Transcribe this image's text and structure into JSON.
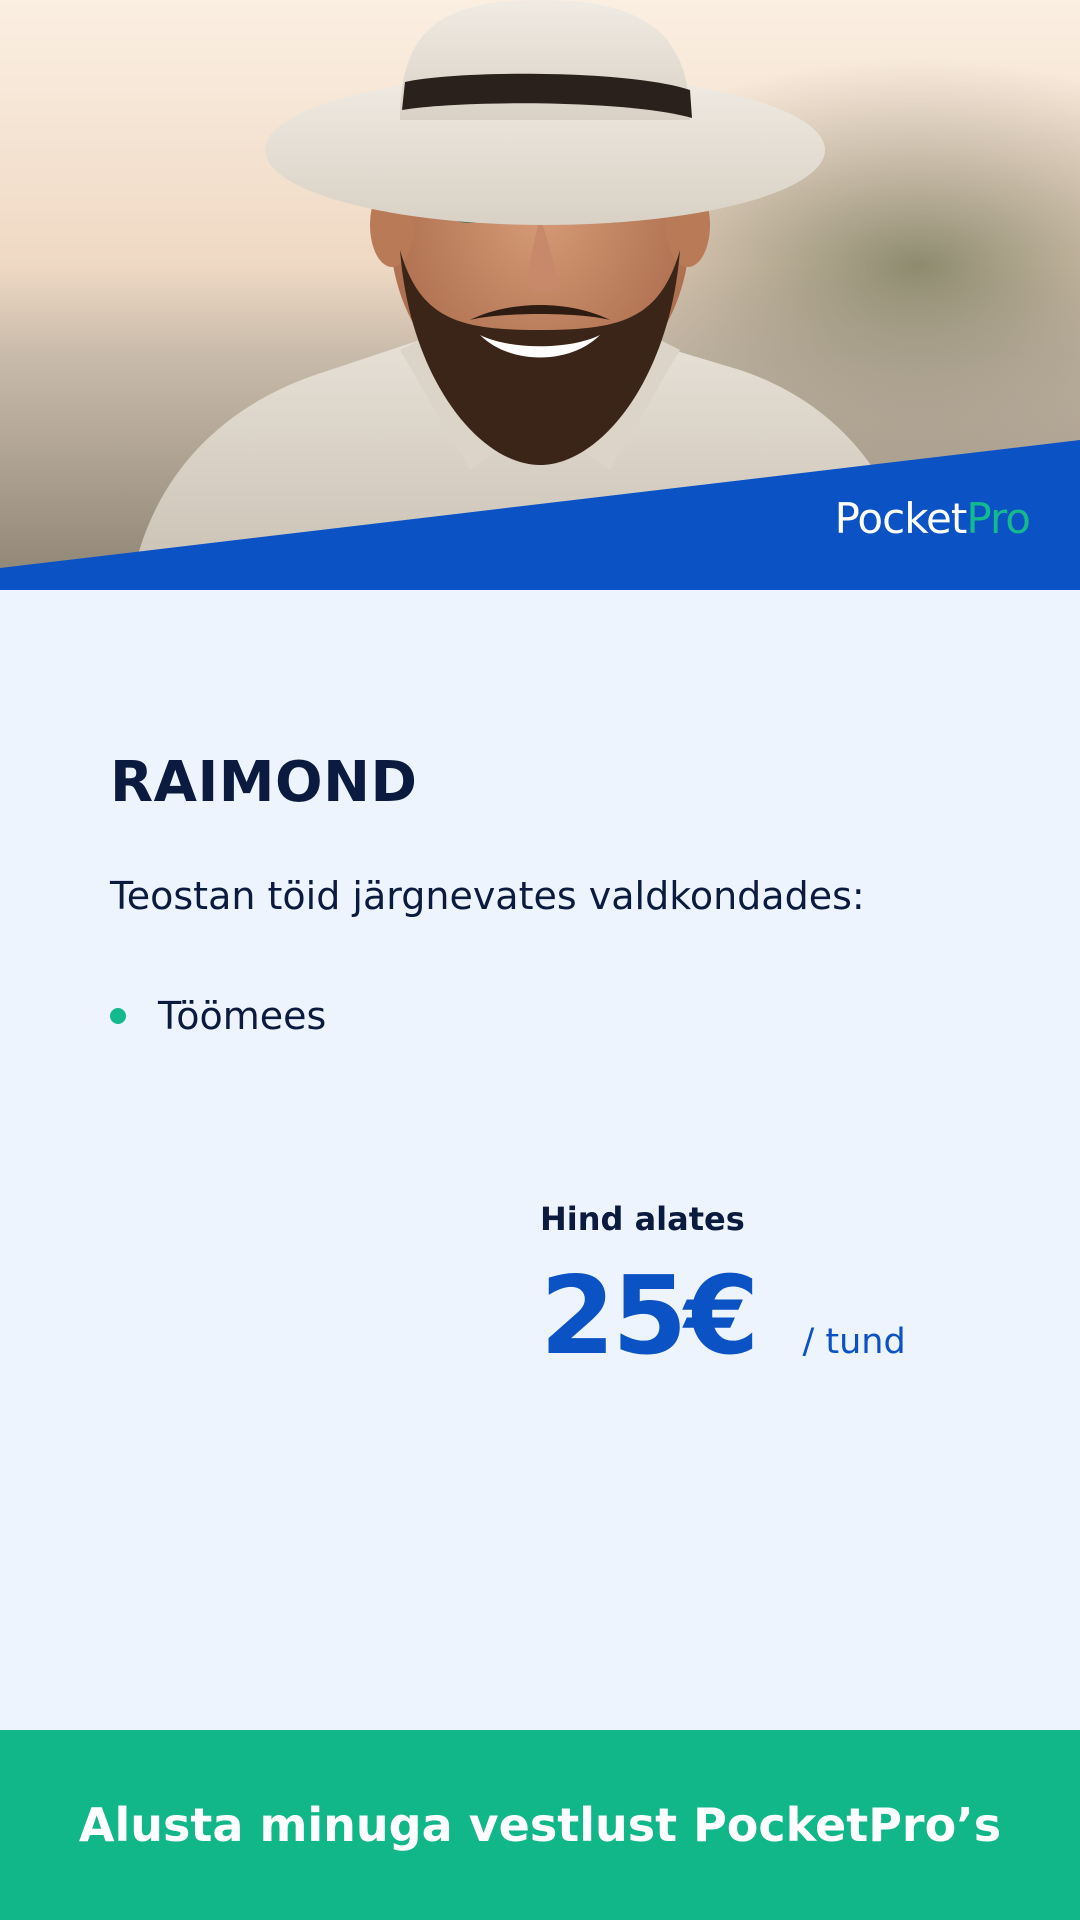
{
  "brand": {
    "part1": "Pocket",
    "part2": "Pro",
    "part1_color": "#FFFFFF",
    "part2_color": "#14B98D",
    "band_color": "#0B52C4"
  },
  "hero": {
    "image": "profile-photo"
  },
  "profile": {
    "name": "RAIMOND",
    "intro": "Teostan töid järgnevates valdkondades:",
    "services": [
      {
        "label": "Töömees"
      }
    ]
  },
  "price": {
    "label": "Hind alates",
    "value": "25€",
    "unit": "/ tund",
    "color": "#0B52C4"
  },
  "cta": {
    "label": "Alusta minuga vestlust PocketPro’s",
    "color": "#11B689"
  },
  "colors": {
    "background": "#EEF4FE",
    "text": "#0B1B3F",
    "accent_green": "#14B98D"
  }
}
